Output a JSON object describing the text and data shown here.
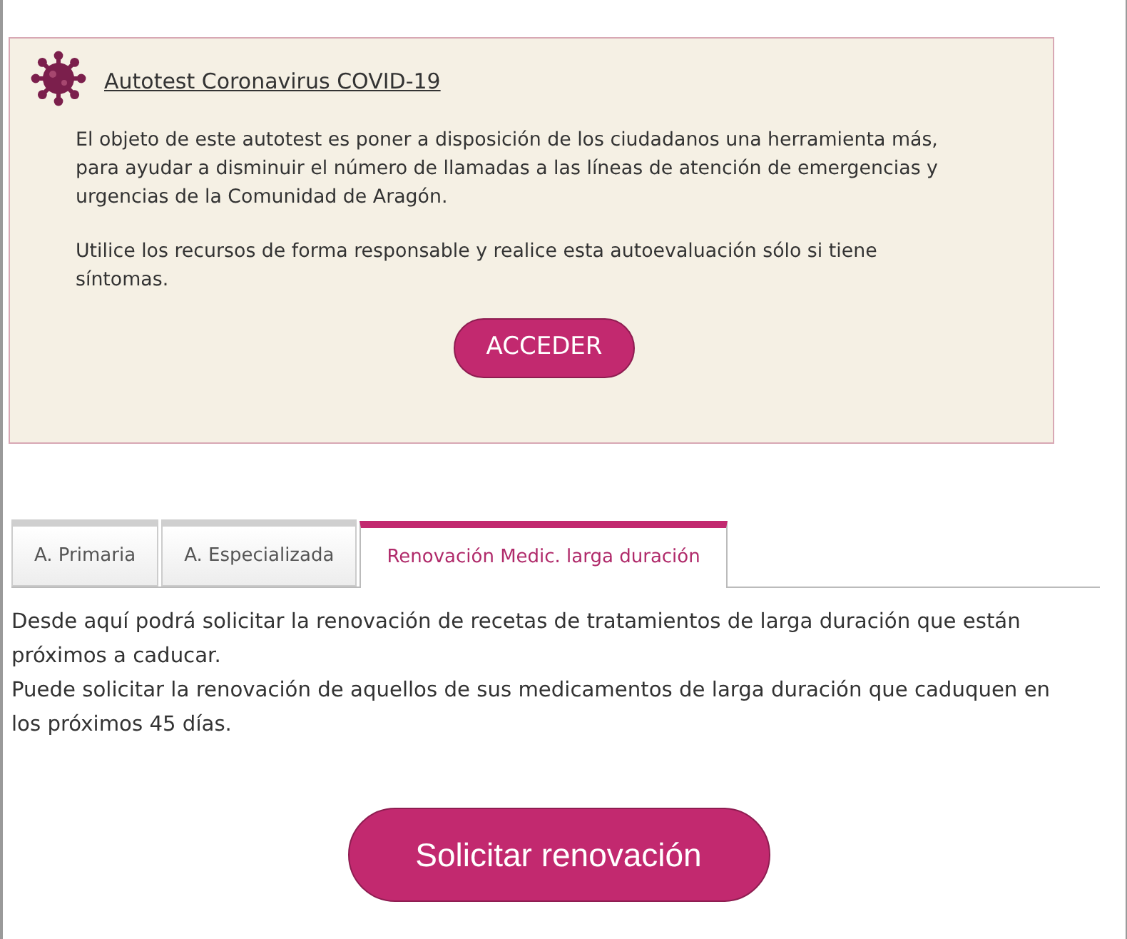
{
  "notice": {
    "title": "Autotest Coronavirus COVID-19",
    "paragraphs": [
      "El objeto de este autotest es poner a disposición de los ciudadanos una herramienta más, para ayudar a disminuir el número de llamadas a las líneas de atención de emergencias y urgencias de la Comunidad de Aragón.",
      "Utilice los recursos de forma responsable y realice esta autoevaluación sólo si tiene síntomas."
    ],
    "button": "ACCEDER"
  },
  "tabs": [
    {
      "label": "A. Primaria",
      "selected": false
    },
    {
      "label": "A. Especializada",
      "selected": false
    },
    {
      "label": "Renovación Medic. larga duración",
      "selected": true
    }
  ],
  "panel": {
    "paragraphs": [
      "Desde aquí podrá solicitar la renovación de recetas de tratamientos de larga duración que están próximos a caducar.",
      "Puede solicitar la renovación de aquellos de sus medicamentos de larga duración que caduquen en los próximos 45 días."
    ],
    "button": "Solicitar renovación"
  }
}
